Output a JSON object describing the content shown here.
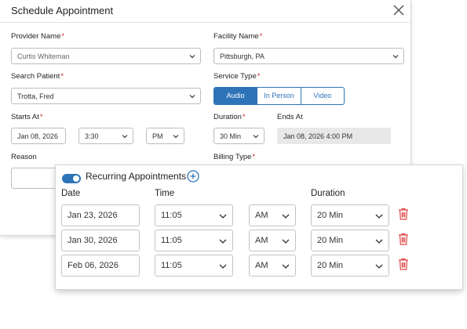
{
  "dialog": {
    "title": "Schedule Appointment",
    "provider": {
      "label": "Provider Name",
      "value": "Curtis Whiteman"
    },
    "facility": {
      "label": "Facility Name",
      "value": "Pittsburgh, PA"
    },
    "patient": {
      "label": "Search Patient",
      "value": "Trotta, Fred"
    },
    "service": {
      "label": "Service Type",
      "options": [
        "Audio",
        "In Person",
        "Video"
      ],
      "selected": "Audio"
    },
    "starts": {
      "label": "Starts At",
      "date": "Jan 08, 2026",
      "time": "3:30",
      "ampm": "PM"
    },
    "duration": {
      "label": "Duration",
      "value": "30 Min"
    },
    "ends": {
      "label": "Ends At",
      "value": "Jan 08, 2026 4:00 PM"
    },
    "reason": {
      "label": "Reason"
    },
    "billing": {
      "label": "Billing Type"
    },
    "required_mark": "*"
  },
  "recurring": {
    "label": "Recurring Appointments",
    "enabled": true,
    "headers": {
      "date": "Date",
      "time": "Time",
      "duration": "Duration"
    },
    "rows": [
      {
        "date": "Jan 23, 2026",
        "time": "11:05",
        "ampm": "AM",
        "duration": "20 Min"
      },
      {
        "date": "Jan 30, 2026",
        "time": "11:05",
        "ampm": "AM",
        "duration": "20 Min"
      },
      {
        "date": "Feb 06, 2026",
        "time": "11:05",
        "ampm": "AM",
        "duration": "20 Min"
      }
    ]
  },
  "colors": {
    "accent": "#2e73b8",
    "danger": "#e04848",
    "required": "#c62828"
  },
  "icons": [
    "close-icon",
    "chevron-down-icon",
    "add-circle-icon",
    "trash-icon"
  ]
}
